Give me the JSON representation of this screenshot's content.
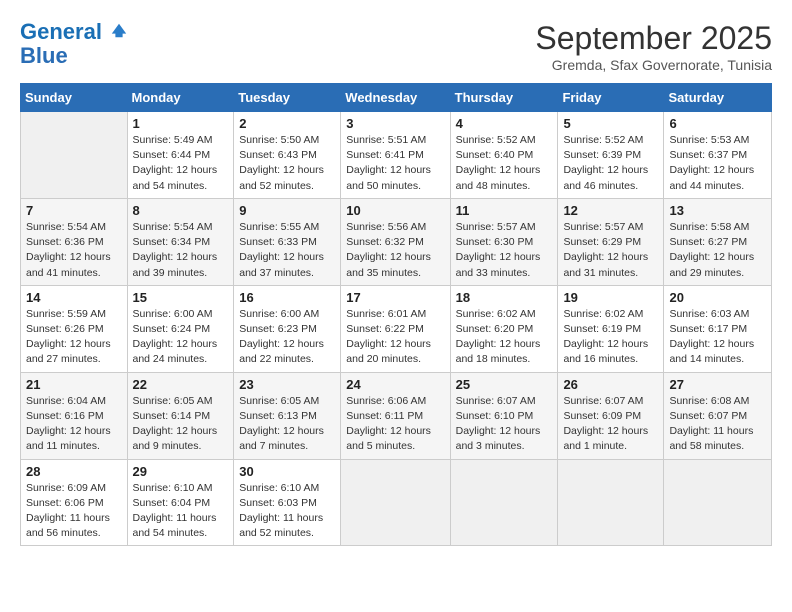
{
  "logo": {
    "line1": "General",
    "line2": "Blue"
  },
  "title": "September 2025",
  "subtitle": "Gremda, Sfax Governorate, Tunisia",
  "weekdays": [
    "Sunday",
    "Monday",
    "Tuesday",
    "Wednesday",
    "Thursday",
    "Friday",
    "Saturday"
  ],
  "weeks": [
    [
      {
        "day": "",
        "info": ""
      },
      {
        "day": "1",
        "info": "Sunrise: 5:49 AM\nSunset: 6:44 PM\nDaylight: 12 hours\nand 54 minutes."
      },
      {
        "day": "2",
        "info": "Sunrise: 5:50 AM\nSunset: 6:43 PM\nDaylight: 12 hours\nand 52 minutes."
      },
      {
        "day": "3",
        "info": "Sunrise: 5:51 AM\nSunset: 6:41 PM\nDaylight: 12 hours\nand 50 minutes."
      },
      {
        "day": "4",
        "info": "Sunrise: 5:52 AM\nSunset: 6:40 PM\nDaylight: 12 hours\nand 48 minutes."
      },
      {
        "day": "5",
        "info": "Sunrise: 5:52 AM\nSunset: 6:39 PM\nDaylight: 12 hours\nand 46 minutes."
      },
      {
        "day": "6",
        "info": "Sunrise: 5:53 AM\nSunset: 6:37 PM\nDaylight: 12 hours\nand 44 minutes."
      }
    ],
    [
      {
        "day": "7",
        "info": "Sunrise: 5:54 AM\nSunset: 6:36 PM\nDaylight: 12 hours\nand 41 minutes."
      },
      {
        "day": "8",
        "info": "Sunrise: 5:54 AM\nSunset: 6:34 PM\nDaylight: 12 hours\nand 39 minutes."
      },
      {
        "day": "9",
        "info": "Sunrise: 5:55 AM\nSunset: 6:33 PM\nDaylight: 12 hours\nand 37 minutes."
      },
      {
        "day": "10",
        "info": "Sunrise: 5:56 AM\nSunset: 6:32 PM\nDaylight: 12 hours\nand 35 minutes."
      },
      {
        "day": "11",
        "info": "Sunrise: 5:57 AM\nSunset: 6:30 PM\nDaylight: 12 hours\nand 33 minutes."
      },
      {
        "day": "12",
        "info": "Sunrise: 5:57 AM\nSunset: 6:29 PM\nDaylight: 12 hours\nand 31 minutes."
      },
      {
        "day": "13",
        "info": "Sunrise: 5:58 AM\nSunset: 6:27 PM\nDaylight: 12 hours\nand 29 minutes."
      }
    ],
    [
      {
        "day": "14",
        "info": "Sunrise: 5:59 AM\nSunset: 6:26 PM\nDaylight: 12 hours\nand 27 minutes."
      },
      {
        "day": "15",
        "info": "Sunrise: 6:00 AM\nSunset: 6:24 PM\nDaylight: 12 hours\nand 24 minutes."
      },
      {
        "day": "16",
        "info": "Sunrise: 6:00 AM\nSunset: 6:23 PM\nDaylight: 12 hours\nand 22 minutes."
      },
      {
        "day": "17",
        "info": "Sunrise: 6:01 AM\nSunset: 6:22 PM\nDaylight: 12 hours\nand 20 minutes."
      },
      {
        "day": "18",
        "info": "Sunrise: 6:02 AM\nSunset: 6:20 PM\nDaylight: 12 hours\nand 18 minutes."
      },
      {
        "day": "19",
        "info": "Sunrise: 6:02 AM\nSunset: 6:19 PM\nDaylight: 12 hours\nand 16 minutes."
      },
      {
        "day": "20",
        "info": "Sunrise: 6:03 AM\nSunset: 6:17 PM\nDaylight: 12 hours\nand 14 minutes."
      }
    ],
    [
      {
        "day": "21",
        "info": "Sunrise: 6:04 AM\nSunset: 6:16 PM\nDaylight: 12 hours\nand 11 minutes."
      },
      {
        "day": "22",
        "info": "Sunrise: 6:05 AM\nSunset: 6:14 PM\nDaylight: 12 hours\nand 9 minutes."
      },
      {
        "day": "23",
        "info": "Sunrise: 6:05 AM\nSunset: 6:13 PM\nDaylight: 12 hours\nand 7 minutes."
      },
      {
        "day": "24",
        "info": "Sunrise: 6:06 AM\nSunset: 6:11 PM\nDaylight: 12 hours\nand 5 minutes."
      },
      {
        "day": "25",
        "info": "Sunrise: 6:07 AM\nSunset: 6:10 PM\nDaylight: 12 hours\nand 3 minutes."
      },
      {
        "day": "26",
        "info": "Sunrise: 6:07 AM\nSunset: 6:09 PM\nDaylight: 12 hours\nand 1 minute."
      },
      {
        "day": "27",
        "info": "Sunrise: 6:08 AM\nSunset: 6:07 PM\nDaylight: 11 hours\nand 58 minutes."
      }
    ],
    [
      {
        "day": "28",
        "info": "Sunrise: 6:09 AM\nSunset: 6:06 PM\nDaylight: 11 hours\nand 56 minutes."
      },
      {
        "day": "29",
        "info": "Sunrise: 6:10 AM\nSunset: 6:04 PM\nDaylight: 11 hours\nand 54 minutes."
      },
      {
        "day": "30",
        "info": "Sunrise: 6:10 AM\nSunset: 6:03 PM\nDaylight: 11 hours\nand 52 minutes."
      },
      {
        "day": "",
        "info": ""
      },
      {
        "day": "",
        "info": ""
      },
      {
        "day": "",
        "info": ""
      },
      {
        "day": "",
        "info": ""
      }
    ]
  ]
}
